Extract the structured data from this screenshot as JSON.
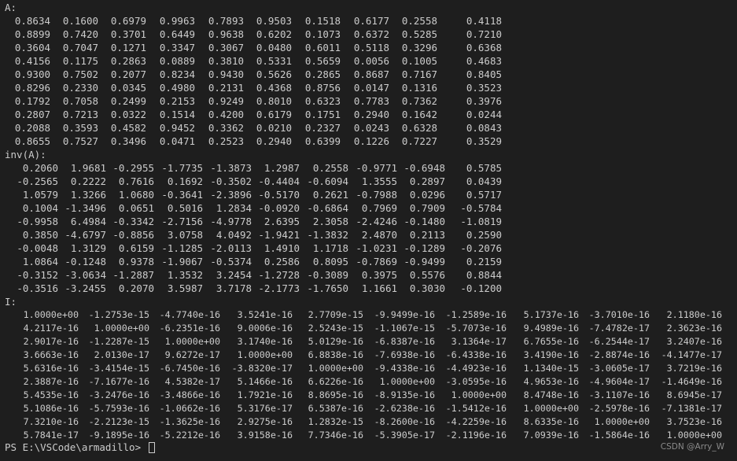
{
  "terminal": {
    "label_a": "A:",
    "label_inv": "inv(A):",
    "label_i": "I:",
    "matrix_a": [
      [
        "0.8634",
        "0.1600",
        "0.6979",
        "0.9963",
        "0.7893",
        "0.9503",
        "0.1518",
        "0.6177",
        "0.2558",
        "0.4118"
      ],
      [
        "0.8899",
        "0.7420",
        "0.3701",
        "0.6449",
        "0.9638",
        "0.6202",
        "0.1073",
        "0.6372",
        "0.5285",
        "0.7210"
      ],
      [
        "0.3604",
        "0.7047",
        "0.1271",
        "0.3347",
        "0.3067",
        "0.0480",
        "0.6011",
        "0.5118",
        "0.3296",
        "0.6368"
      ],
      [
        "0.4156",
        "0.1175",
        "0.2863",
        "0.0889",
        "0.3810",
        "0.5331",
        "0.5659",
        "0.0056",
        "0.1005",
        "0.4683"
      ],
      [
        "0.9300",
        "0.7502",
        "0.2077",
        "0.8234",
        "0.9430",
        "0.5626",
        "0.2865",
        "0.8687",
        "0.7167",
        "0.8405"
      ],
      [
        "0.8296",
        "0.2330",
        "0.0345",
        "0.4980",
        "0.2131",
        "0.4368",
        "0.8756",
        "0.0147",
        "0.1316",
        "0.3523"
      ],
      [
        "0.1792",
        "0.7058",
        "0.2499",
        "0.2153",
        "0.9249",
        "0.8010",
        "0.6323",
        "0.7783",
        "0.7362",
        "0.3976"
      ],
      [
        "0.2807",
        "0.7213",
        "0.0322",
        "0.1514",
        "0.4200",
        "0.6179",
        "0.1751",
        "0.2940",
        "0.1642",
        "0.0244"
      ],
      [
        "0.2088",
        "0.3593",
        "0.4582",
        "0.9452",
        "0.3362",
        "0.0210",
        "0.2327",
        "0.0243",
        "0.6328",
        "0.0843"
      ],
      [
        "0.8655",
        "0.7527",
        "0.3496",
        "0.0471",
        "0.2523",
        "0.2940",
        "0.6399",
        "0.1226",
        "0.7227",
        "0.3529"
      ]
    ],
    "matrix_inv": [
      [
        "0.2060",
        "1.9681",
        "-0.2955",
        "-1.7735",
        "-1.3873",
        "1.2987",
        "0.2558",
        "-0.9771",
        "-0.6948",
        "0.5785"
      ],
      [
        "-0.2565",
        "0.2222",
        "0.7616",
        "0.1692",
        "-0.3502",
        "-0.4404",
        "-0.6094",
        "1.3555",
        "0.2897",
        "0.0439"
      ],
      [
        "1.0579",
        "1.3266",
        "1.0680",
        "-0.3641",
        "-2.3896",
        "-0.5170",
        "0.2621",
        "-0.7988",
        "0.0296",
        "0.5717"
      ],
      [
        "0.1004",
        "-1.3496",
        "0.0651",
        "0.5016",
        "1.2834",
        "-0.0920",
        "-0.6864",
        "0.7969",
        "0.7909",
        "-0.5784"
      ],
      [
        "-0.9958",
        "6.4984",
        "-0.3342",
        "-2.7156",
        "-4.9778",
        "2.6395",
        "2.3058",
        "-2.4246",
        "-0.1480",
        "-1.0819"
      ],
      [
        "0.3850",
        "-4.6797",
        "-0.8856",
        "3.0758",
        "4.0492",
        "-1.9421",
        "-1.3832",
        "2.4870",
        "0.2113",
        "0.2590"
      ],
      [
        "-0.0048",
        "1.3129",
        "0.6159",
        "-1.1285",
        "-2.0113",
        "1.4910",
        "1.1718",
        "-1.0231",
        "-0.1289",
        "-0.2076"
      ],
      [
        "1.0864",
        "-0.1248",
        "0.9378",
        "-1.9067",
        "-0.5374",
        "0.2586",
        "0.8095",
        "-0.7869",
        "-0.9499",
        "0.2159"
      ],
      [
        "-0.3152",
        "-3.0634",
        "-1.2887",
        "1.3532",
        "3.2454",
        "-1.2728",
        "-0.3089",
        "0.3975",
        "0.5576",
        "0.8844"
      ],
      [
        "-0.3516",
        "-3.2455",
        "0.2070",
        "3.5987",
        "3.7178",
        "-2.1773",
        "-1.7650",
        "1.1661",
        "0.3030",
        "-0.1200"
      ]
    ],
    "matrix_i": [
      [
        "1.0000e+00",
        "-1.2753e-15",
        "-4.7740e-16",
        "3.5241e-16",
        "2.7709e-15",
        "-9.9499e-16",
        "-1.2589e-16",
        "5.1737e-16",
        "-3.7010e-16",
        "2.1180e-16"
      ],
      [
        "4.2117e-16",
        "1.0000e+00",
        "-6.2351e-16",
        "9.0006e-16",
        "2.5243e-15",
        "-1.1067e-15",
        "-5.7073e-16",
        "9.4989e-16",
        "-7.4782e-17",
        "2.3623e-16"
      ],
      [
        "2.9017e-16",
        "-1.2287e-15",
        "1.0000e+00",
        "3.1740e-16",
        "5.0129e-16",
        "-6.8387e-16",
        "3.1364e-17",
        "6.7655e-16",
        "-6.2544e-17",
        "3.2407e-16"
      ],
      [
        "3.6663e-16",
        "2.0130e-17",
        "9.6272e-17",
        "1.0000e+00",
        "6.8838e-16",
        "-7.6938e-16",
        "-6.4338e-16",
        "3.4190e-16",
        "-2.8874e-16",
        "-4.1477e-17"
      ],
      [
        "5.6316e-16",
        "-3.4154e-15",
        "-6.7450e-16",
        "-3.8320e-17",
        "1.0000e+00",
        "-9.4338e-16",
        "-4.4923e-16",
        "1.1340e-15",
        "-3.0605e-17",
        "3.7219e-16"
      ],
      [
        "2.3887e-16",
        "-7.1677e-16",
        "4.5382e-17",
        "5.1466e-16",
        "6.6226e-16",
        "1.0000e+00",
        "-3.0595e-16",
        "4.9653e-16",
        "-4.9604e-17",
        "-1.4649e-16"
      ],
      [
        "5.4535e-16",
        "-3.2476e-16",
        "-3.4866e-16",
        "1.7921e-16",
        "8.8695e-16",
        "-8.9135e-16",
        "1.0000e+00",
        "8.4748e-16",
        "-3.1107e-16",
        "8.6945e-17"
      ],
      [
        "5.1086e-16",
        "-5.7593e-16",
        "-1.0662e-16",
        "5.3176e-17",
        "6.5387e-16",
        "-2.6238e-16",
        "-1.5412e-16",
        "1.0000e+00",
        "-2.5978e-16",
        "-7.1381e-17"
      ],
      [
        "7.3210e-16",
        "-2.2123e-15",
        "-1.3625e-16",
        "2.9275e-16",
        "1.2832e-15",
        "-8.2600e-16",
        "-4.2259e-16",
        "8.6335e-16",
        "1.0000e+00",
        "3.7523e-16"
      ],
      [
        "5.7841e-17",
        "-9.1895e-16",
        "-5.2212e-16",
        "3.9158e-16",
        "7.7346e-16",
        "-5.3905e-17",
        "-2.1196e-16",
        "7.0939e-16",
        "-1.5864e-16",
        "1.0000e+00"
      ]
    ],
    "prompt": "PS E:\\VSCode\\armadillo> "
  },
  "watermark": "CSDN @Arry_W",
  "colors": {
    "background": "#1e1e1e",
    "text": "#cccccc",
    "watermark": "#8a8a8a"
  }
}
